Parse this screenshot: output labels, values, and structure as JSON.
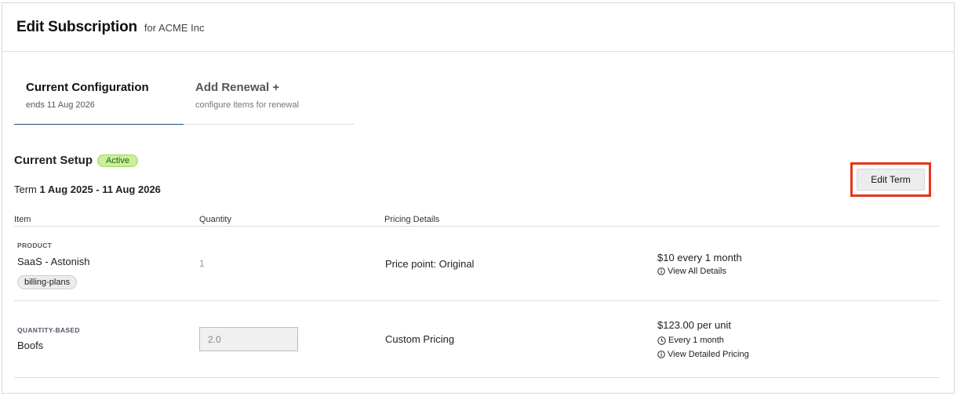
{
  "header": {
    "title": "Edit Subscription",
    "subtitle": "for ACME Inc"
  },
  "tabs": [
    {
      "label": "Current Configuration",
      "sub": "ends 11 Aug 2026"
    },
    {
      "label": "Add Renewal +",
      "sub": "configure items for renewal"
    }
  ],
  "setup": {
    "title": "Current Setup",
    "status": "Active",
    "term_label": "Term",
    "term_dates": "1 Aug 2025 - 11 Aug 2026",
    "edit_term_label": "Edit Term"
  },
  "table": {
    "columns": [
      "Item",
      "Quantity",
      "Pricing Details"
    ],
    "rows": [
      {
        "category": "PRODUCT",
        "name": "SaaS - Astonish",
        "tag": "billing-plans",
        "quantity": "1",
        "pricing": "Price point: Original",
        "price": "$10 every 1 month",
        "links": [
          "View All Details"
        ]
      },
      {
        "category": "QUANTITY-BASED",
        "name": "Boofs",
        "quantity": "2.0",
        "pricing": "Custom Pricing",
        "price": "$123.00 per unit",
        "links": [
          "Every 1 month",
          "View Detailed Pricing"
        ]
      }
    ]
  },
  "icons": {
    "info": "info-icon",
    "clock": "clock-icon"
  },
  "colors": {
    "badge_bg": "#c8f09a",
    "highlight": "#e8341a",
    "tab_underline": "#1f4e79"
  }
}
